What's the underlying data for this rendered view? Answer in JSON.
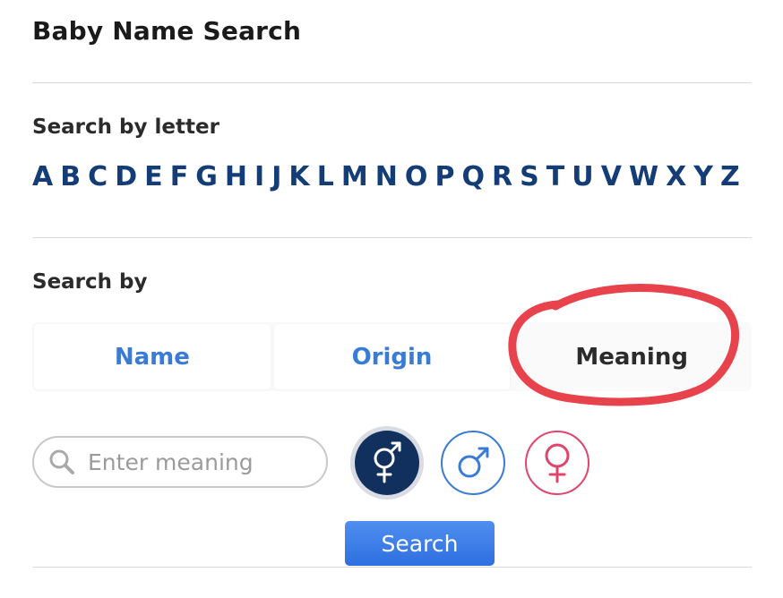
{
  "page_title": "Baby Name Search",
  "letter_section": {
    "label": "Search by letter",
    "letters": [
      "A",
      "B",
      "C",
      "D",
      "E",
      "F",
      "G",
      "H",
      "I",
      "J",
      "K",
      "L",
      "M",
      "N",
      "O",
      "P",
      "Q",
      "R",
      "S",
      "T",
      "U",
      "V",
      "W",
      "X",
      "Y",
      "Z"
    ]
  },
  "search_by": {
    "label": "Search by",
    "tabs": [
      {
        "label": "Name",
        "active": false
      },
      {
        "label": "Origin",
        "active": false
      },
      {
        "label": "Meaning",
        "active": true
      }
    ]
  },
  "search": {
    "placeholder": "Enter meaning",
    "icon": "search-icon",
    "button_label": "Search"
  },
  "gender_options": [
    {
      "id": "both",
      "icon": "gender-both-icon",
      "selected": true
    },
    {
      "id": "male",
      "icon": "male-icon",
      "selected": false
    },
    {
      "id": "female",
      "icon": "female-icon",
      "selected": false
    }
  ],
  "colors": {
    "letter_link": "#143d78",
    "tab_link": "#3a7bd5",
    "selected_gender_bg": "#12305e",
    "female_accent": "#e0456b",
    "button": "#3b7ee8",
    "annotation": "#e8424c"
  }
}
